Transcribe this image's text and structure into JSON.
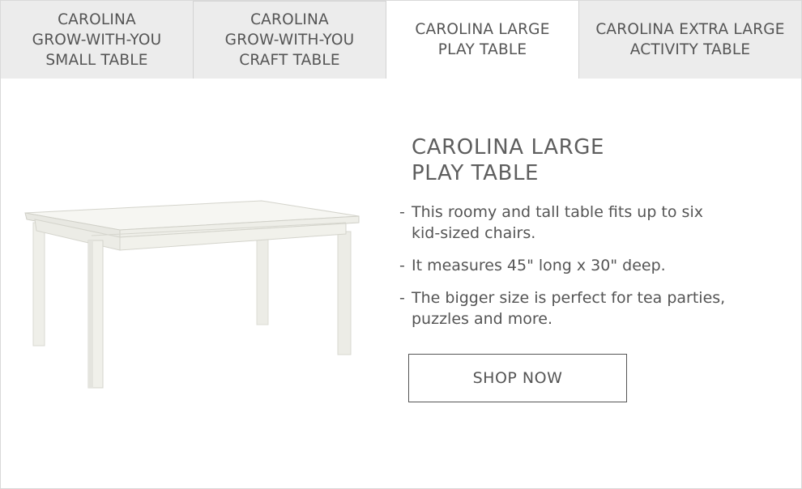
{
  "tabs": [
    {
      "label": "CAROLINA\nGROW-WITH-YOU\nSMALL TABLE",
      "active": false
    },
    {
      "label": "CAROLINA\nGROW-WITH-YOU\nCRAFT TABLE",
      "active": false
    },
    {
      "label": "CAROLINA LARGE\nPLAY TABLE",
      "active": true
    },
    {
      "label": "CAROLINA EXTRA LARGE\nACTIVITY TABLE",
      "active": false
    }
  ],
  "product": {
    "title": "CAROLINA LARGE\nPLAY TABLE",
    "bullets": [
      "This roomy and tall table fits up to six kid-sized chairs.",
      "It measures 45\" long x 30\" deep.",
      "The bigger size is perfect for tea parties, puzzles and more."
    ],
    "bullet_marker": "-",
    "cta_label": "SHOP NOW"
  },
  "colors": {
    "tab_inactive": "#ececec",
    "tab_active": "#ffffff",
    "text": "#555555",
    "table_white": "#f4f4f0"
  }
}
